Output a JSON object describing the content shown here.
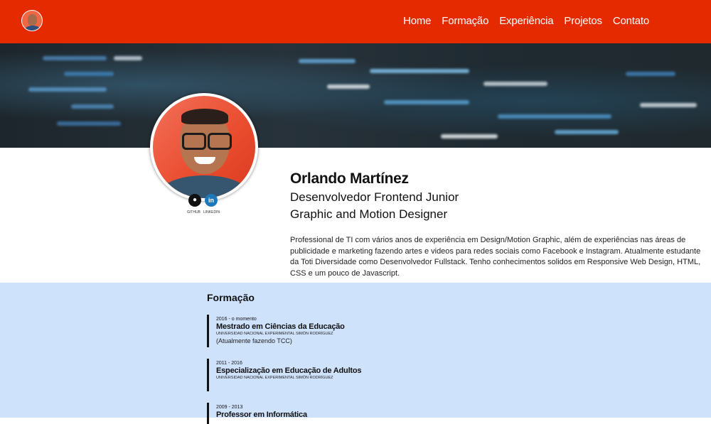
{
  "nav": {
    "items": [
      "Home",
      "Formação",
      "Experiência",
      "Projetos",
      "Contato"
    ]
  },
  "colors": {
    "topbar": "#e62a00",
    "education_bg": "#cfe2fc",
    "accent_border": "#111111"
  },
  "profile": {
    "name": "Orlando Martínez",
    "role_1": "Desenvolvedor Frontend Junior",
    "role_2": "Graphic and Motion Designer",
    "bio": "Professional de TI com vários anos de experiência em Design/Motion Graphic, além de experiências nas áreas de publicidade e marketing fazendo artes e videos para redes sociais como Facebook e Instagram. Atualmente estudante da Toti Diversidade como Desenvolvedor Fullstack. Tenho conhecimentos solidos em Responsive Web Design, HTML, CSS e um pouco de Javascript.",
    "social": {
      "github_label": "GITHUB",
      "github_icon": "github-icon",
      "linkedin_label": "LINKEDIN",
      "linkedin_icon": "linkedin-icon",
      "linkedin_glyph": "in"
    }
  },
  "education": {
    "title": "Formação",
    "items": [
      {
        "date": "2016 - o momento",
        "degree": "Mestrado em Ciências da Educação",
        "school": "UNIVERSIDAD NACIONAL EXPERIMENTAL SIMÓN RODRÍGUEZ",
        "note": "(Atualmente fazendo TCC)"
      },
      {
        "date": "2011 - 2016",
        "degree": "Especialização em Educação de Adultos",
        "school": "UNIVERSIDAD NACIONAL EXPERIMENTAL SIMÓN RODRÍGUEZ",
        "note": ""
      },
      {
        "date": "2009 - 2013",
        "degree": "Professor em Informática",
        "school": "",
        "note": ""
      }
    ]
  }
}
